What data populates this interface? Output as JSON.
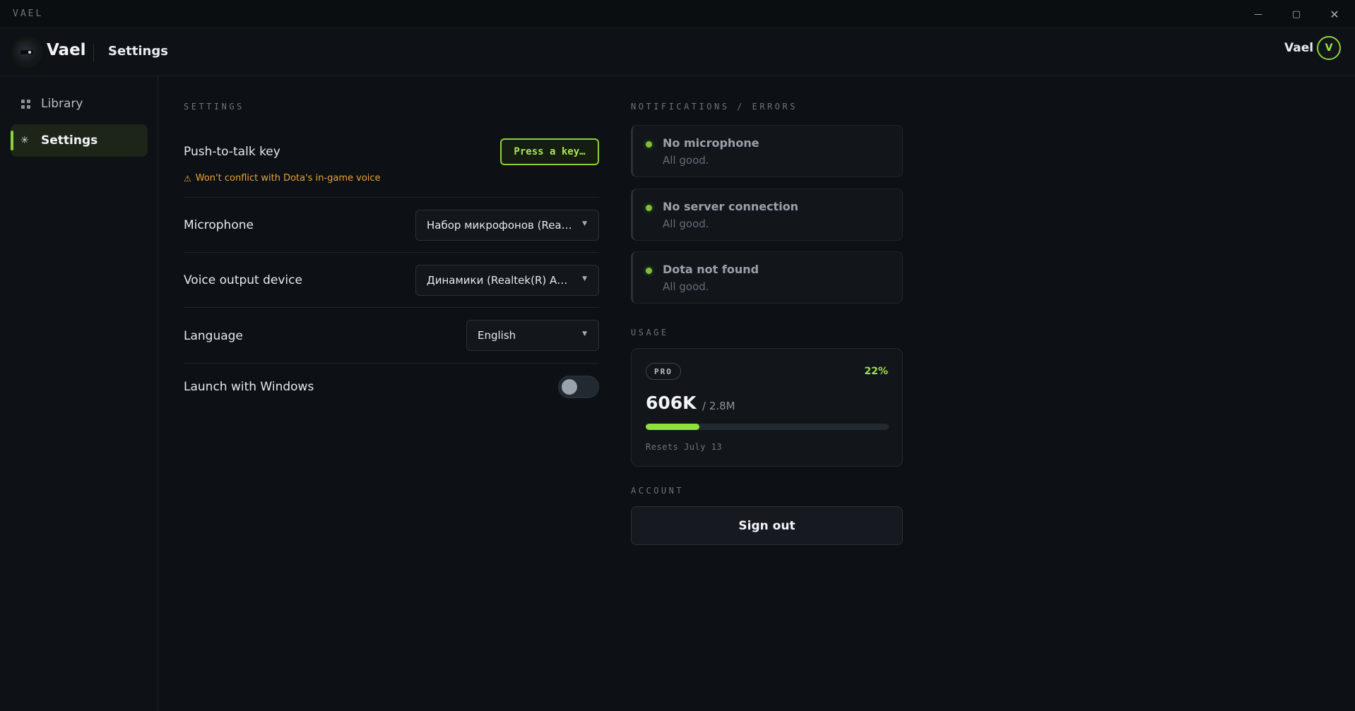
{
  "window": {
    "title": "VAEL",
    "controls": {
      "minimize": "—",
      "maximize": "▢",
      "close": "✕"
    }
  },
  "header": {
    "brand": "Vael",
    "breadcrumb": "Settings",
    "user": {
      "name": "Vael",
      "initial": "V"
    }
  },
  "sidebar": {
    "items": [
      {
        "label": "Library",
        "icon": "grid-icon",
        "active": false
      },
      {
        "label": "Settings",
        "icon": "gear-icon",
        "active": true
      }
    ]
  },
  "settings": {
    "section_label": "SETTINGS",
    "ptt": {
      "label": "Push-to-talk key",
      "button": "Press a key…",
      "warning": "Won't conflict with Dota's in-game voice"
    },
    "microphone": {
      "label": "Microphone",
      "value": "Набор микрофонов (Realtek(R) Audio)"
    },
    "output": {
      "label": "Voice output device",
      "value": "Динамики (Realtek(R) Audio)"
    },
    "language": {
      "label": "Language",
      "value": "English"
    },
    "launch": {
      "label": "Launch with Windows",
      "enabled": false
    }
  },
  "notifications": {
    "section_label": "NOTIFICATIONS / ERRORS",
    "items": [
      {
        "title": "No microphone",
        "status": "All good."
      },
      {
        "title": "No server connection",
        "status": "All good."
      },
      {
        "title": "Dota not found",
        "status": "All good."
      }
    ]
  },
  "usage": {
    "section_label": "USAGE",
    "plan": "PRO",
    "percent": "22%",
    "fraction": 0.22,
    "used": "606K",
    "limit": "/ 2.8M",
    "resets": "Resets July 13"
  },
  "account": {
    "section_label": "ACCOUNT",
    "sign_out": "Sign out"
  },
  "colors": {
    "accent": "#8bd33a",
    "warning": "#e8a33a",
    "background": "#0d1014"
  }
}
